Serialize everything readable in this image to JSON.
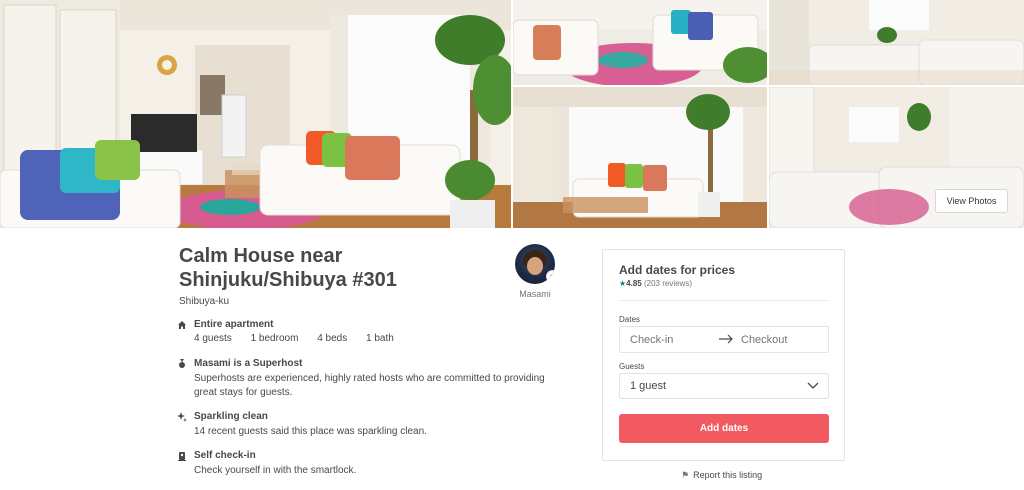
{
  "gallery": {
    "view_photos_label": "View Photos"
  },
  "listing": {
    "title_line1": "Calm House near",
    "title_line2": "Shinjuku/Shibuya #301",
    "location": "Shibuya-ku"
  },
  "host": {
    "name": "Masami",
    "badge_icon": "heart-icon"
  },
  "features": {
    "apartment": {
      "icon": "home-icon",
      "title": "Entire apartment",
      "stats": [
        "4 guests",
        "1 bedroom",
        "4 beds",
        "1 bath"
      ]
    },
    "superhost": {
      "icon": "medal-icon",
      "title": "Masami is a Superhost",
      "text": "Superhosts are experienced, highly rated hosts who are committed to providing great stays for guests."
    },
    "clean": {
      "icon": "sparkle-icon",
      "title": "Sparkling clean",
      "text": "14 recent guests said this place was sparkling clean."
    },
    "checkin": {
      "icon": "lock-icon",
      "title": "Self check-in",
      "text": "Check yourself in with the smartlock."
    }
  },
  "booking": {
    "title": "Add dates for prices",
    "rating": "4.85",
    "reviews": "(203 reviews)",
    "dates_label": "Dates",
    "checkin_placeholder": "Check-in",
    "checkout_placeholder": "Checkout",
    "guests_label": "Guests",
    "guests_value": "1 guest",
    "button_label": "Add dates",
    "accent_color": "#f25a62",
    "rating_star_color": "#008489"
  },
  "report": {
    "label": "Report this listing"
  }
}
